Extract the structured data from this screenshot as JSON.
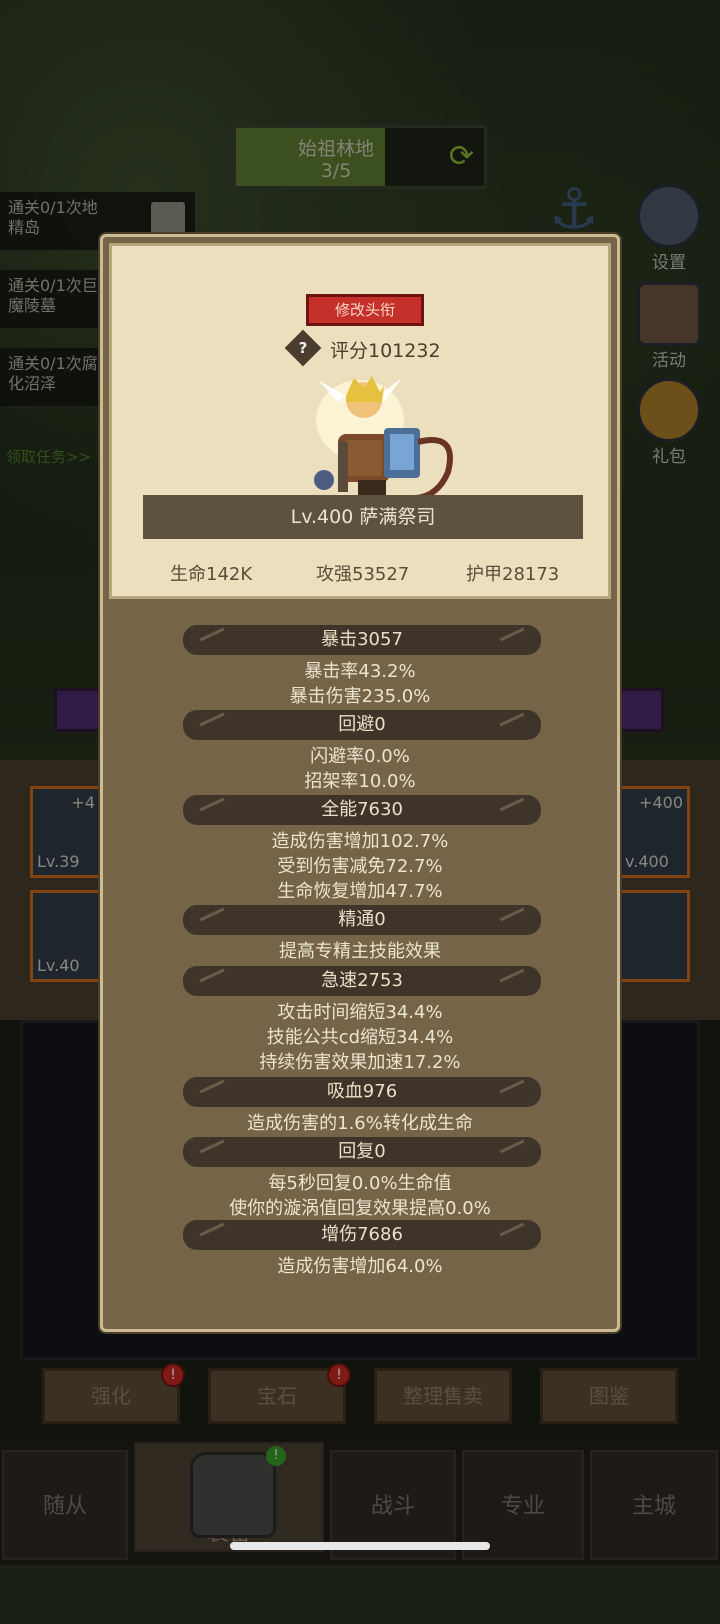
{
  "background": {
    "zone": {
      "name": "始祖林地",
      "progress": "3/5",
      "progress_ratio": 0.6
    },
    "quests": [
      {
        "text_line1": "通关0/1次地",
        "text_line2": "精岛"
      },
      {
        "text_line1": "通关0/1次巨",
        "text_line2": "魔陵墓"
      },
      {
        "text_line1": "通关0/1次腐",
        "text_line2": "化沼泽"
      }
    ],
    "quest_link": "领取任务>>",
    "side_buttons": [
      {
        "label": "设置",
        "icon": "gear-icon"
      },
      {
        "label": "活动",
        "icon": "scroll-icon"
      },
      {
        "label": "礼包",
        "icon": "gift-icon"
      }
    ],
    "equip_slots": [
      {
        "top": "+4",
        "bottom": "Lv.39"
      },
      {
        "top": "+400",
        "bottom": "v.400"
      },
      {
        "top": "",
        "bottom": "Lv.40"
      },
      {
        "top": "",
        "bottom": ""
      }
    ],
    "actions": [
      {
        "label": "强化",
        "alert": "!"
      },
      {
        "label": "宝石",
        "alert": "!"
      },
      {
        "label": "整理售卖",
        "alert": ""
      },
      {
        "label": "图鉴",
        "alert": ""
      }
    ],
    "nav": [
      {
        "label": "随从"
      },
      {
        "label": "装备"
      },
      {
        "label": "战斗"
      },
      {
        "label": "专业"
      },
      {
        "label": "主城"
      }
    ],
    "nav_alert": "!"
  },
  "panel": {
    "title_button": "修改头衔",
    "score": "评分101232",
    "hero_name": "Lv.400 萨满祭司",
    "stats": {
      "hp": "生命142K",
      "atk": "攻强53527",
      "armor": "护甲28173"
    },
    "sections": [
      {
        "header": "暴击3057",
        "lines": [
          "暴击率43.2%",
          "暴击伤害235.0%"
        ]
      },
      {
        "header": "回避0",
        "lines": [
          "闪避率0.0%",
          "招架率10.0%"
        ]
      },
      {
        "header": "全能7630",
        "lines": [
          "造成伤害增加102.7%",
          "受到伤害减免72.7%",
          "生命恢复增加47.7%"
        ]
      },
      {
        "header": "精通0",
        "lines": [
          "提高专精主技能效果"
        ]
      },
      {
        "header": "急速2753",
        "lines": [
          "攻击时间缩短34.4%",
          "技能公共cd缩短34.4%",
          "持续伤害效果加速17.2%"
        ]
      },
      {
        "header": "吸血976",
        "lines": [
          "造成伤害的1.6%转化成生命"
        ]
      },
      {
        "header": "回复0",
        "lines": [
          "每5秒回复0.0%生命值",
          "使你的漩涡值回复效果提高0.0%"
        ]
      },
      {
        "header": "增伤7686",
        "lines": [
          "造成伤害增加64.0%"
        ]
      }
    ]
  }
}
